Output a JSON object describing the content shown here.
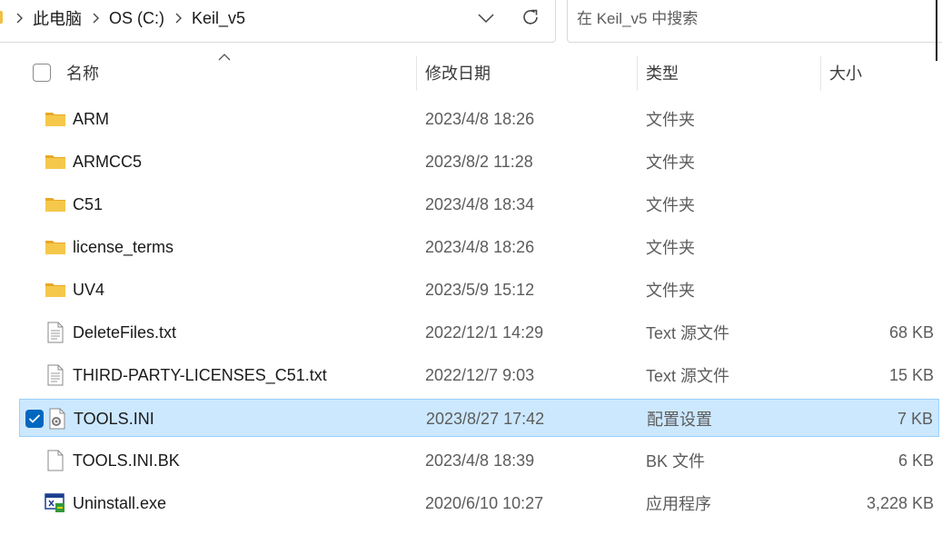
{
  "address_bar": {
    "crumbs": [
      "此电脑",
      "OS (C:)",
      "Keil_v5"
    ],
    "dropdown_icon": "chevron-down-icon",
    "refresh_icon": "refresh-icon"
  },
  "search": {
    "placeholder": "在 Keil_v5 中搜索",
    "value": ""
  },
  "columns": {
    "name": "名称",
    "date": "修改日期",
    "type": "类型",
    "size": "大小",
    "sort_indicator": "sort-ascending-icon"
  },
  "files": [
    {
      "name": "ARM",
      "date": "2023/4/8 18:26",
      "type": "文件夹",
      "size": "",
      "icon": "folder-icon",
      "selected": false
    },
    {
      "name": "ARMCC5",
      "date": "2023/8/2 11:28",
      "type": "文件夹",
      "size": "",
      "icon": "folder-icon",
      "selected": false
    },
    {
      "name": "C51",
      "date": "2023/4/8 18:34",
      "type": "文件夹",
      "size": "",
      "icon": "folder-icon",
      "selected": false
    },
    {
      "name": "license_terms",
      "date": "2023/4/8 18:26",
      "type": "文件夹",
      "size": "",
      "icon": "folder-icon",
      "selected": false
    },
    {
      "name": "UV4",
      "date": "2023/5/9 15:12",
      "type": "文件夹",
      "size": "",
      "icon": "folder-icon",
      "selected": false
    },
    {
      "name": "DeleteFiles.txt",
      "date": "2022/12/1 14:29",
      "type": "Text 源文件",
      "size": "68 KB",
      "icon": "text-file-icon",
      "selected": false
    },
    {
      "name": "THIRD-PARTY-LICENSES_C51.txt",
      "date": "2022/12/7 9:03",
      "type": "Text 源文件",
      "size": "15 KB",
      "icon": "text-file-icon",
      "selected": false
    },
    {
      "name": "TOOLS.INI",
      "date": "2023/8/27 17:42",
      "type": "配置设置",
      "size": "7 KB",
      "icon": "settings-file-icon",
      "selected": true
    },
    {
      "name": "TOOLS.INI.BK",
      "date": "2023/4/8 18:39",
      "type": "BK 文件",
      "size": "6 KB",
      "icon": "blank-file-icon",
      "selected": false
    },
    {
      "name": "Uninstall.exe",
      "date": "2020/6/10 10:27",
      "type": "应用程序",
      "size": "3,228 KB",
      "icon": "application-icon",
      "selected": false
    }
  ],
  "colors": {
    "selection_background": "#cce8ff",
    "selection_border": "#99d1ff",
    "checkbox_checked": "#0067c0",
    "folder": "#f0c043"
  }
}
